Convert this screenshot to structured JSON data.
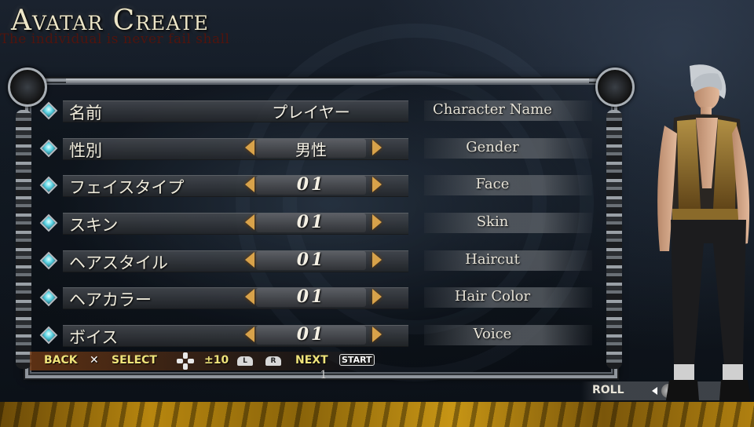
{
  "title": "Avatar Create",
  "subtitle": "The individual is never fail shall",
  "rows": [
    {
      "label": "名前",
      "value": "プレイヤー",
      "english": "Character Name",
      "has_arrows": false
    },
    {
      "label": "性別",
      "value": "男性",
      "english": "Gender",
      "has_arrows": true
    },
    {
      "label": "フェイスタイプ",
      "value": "01",
      "english": "Face",
      "has_arrows": true
    },
    {
      "label": "スキン",
      "value": "01",
      "english": "Skin",
      "has_arrows": true
    },
    {
      "label": "ヘアスタイル",
      "value": "01",
      "english": "Haircut",
      "has_arrows": true
    },
    {
      "label": "ヘアカラー",
      "value": "01",
      "english": "Hair Color",
      "has_arrows": true
    },
    {
      "label": "ボイス",
      "value": "01",
      "english": "Voice",
      "has_arrows": true
    }
  ],
  "controls": {
    "back_label": "BACK",
    "back_button": "✕",
    "select_label": "SELECT",
    "step_label": "±10",
    "l_button": "L",
    "r_button": "R",
    "next_label": "NEXT",
    "start_label": "START"
  },
  "page_number": "1",
  "roll_label": "ROLL",
  "colors": {
    "gold_band": "#b7860f",
    "arrow": "#d8a24a",
    "gem": "#5fd6e6",
    "control_text": "#efe37a"
  },
  "icons": {
    "row_marker": "diamond-gem-icon",
    "dpad": "dpad-icon",
    "cross": "cross-button-icon"
  }
}
